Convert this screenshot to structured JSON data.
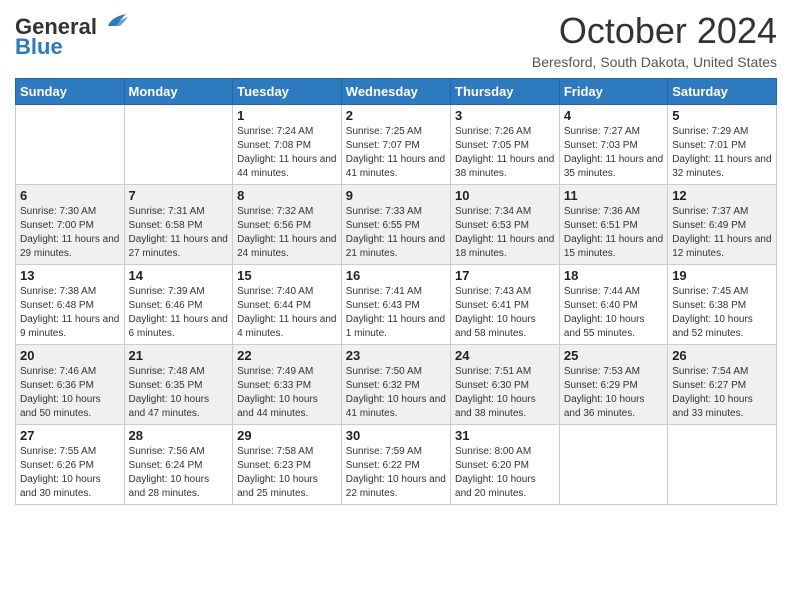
{
  "header": {
    "logo_general": "General",
    "logo_blue": "Blue",
    "month_title": "October 2024",
    "subtitle": "Beresford, South Dakota, United States"
  },
  "days_of_week": [
    "Sunday",
    "Monday",
    "Tuesday",
    "Wednesday",
    "Thursday",
    "Friday",
    "Saturday"
  ],
  "weeks": [
    [
      {
        "day": "",
        "sunrise": "",
        "sunset": "",
        "daylight": ""
      },
      {
        "day": "",
        "sunrise": "",
        "sunset": "",
        "daylight": ""
      },
      {
        "day": "1",
        "sunrise": "Sunrise: 7:24 AM",
        "sunset": "Sunset: 7:08 PM",
        "daylight": "Daylight: 11 hours and 44 minutes."
      },
      {
        "day": "2",
        "sunrise": "Sunrise: 7:25 AM",
        "sunset": "Sunset: 7:07 PM",
        "daylight": "Daylight: 11 hours and 41 minutes."
      },
      {
        "day": "3",
        "sunrise": "Sunrise: 7:26 AM",
        "sunset": "Sunset: 7:05 PM",
        "daylight": "Daylight: 11 hours and 38 minutes."
      },
      {
        "day": "4",
        "sunrise": "Sunrise: 7:27 AM",
        "sunset": "Sunset: 7:03 PM",
        "daylight": "Daylight: 11 hours and 35 minutes."
      },
      {
        "day": "5",
        "sunrise": "Sunrise: 7:29 AM",
        "sunset": "Sunset: 7:01 PM",
        "daylight": "Daylight: 11 hours and 32 minutes."
      }
    ],
    [
      {
        "day": "6",
        "sunrise": "Sunrise: 7:30 AM",
        "sunset": "Sunset: 7:00 PM",
        "daylight": "Daylight: 11 hours and 29 minutes."
      },
      {
        "day": "7",
        "sunrise": "Sunrise: 7:31 AM",
        "sunset": "Sunset: 6:58 PM",
        "daylight": "Daylight: 11 hours and 27 minutes."
      },
      {
        "day": "8",
        "sunrise": "Sunrise: 7:32 AM",
        "sunset": "Sunset: 6:56 PM",
        "daylight": "Daylight: 11 hours and 24 minutes."
      },
      {
        "day": "9",
        "sunrise": "Sunrise: 7:33 AM",
        "sunset": "Sunset: 6:55 PM",
        "daylight": "Daylight: 11 hours and 21 minutes."
      },
      {
        "day": "10",
        "sunrise": "Sunrise: 7:34 AM",
        "sunset": "Sunset: 6:53 PM",
        "daylight": "Daylight: 11 hours and 18 minutes."
      },
      {
        "day": "11",
        "sunrise": "Sunrise: 7:36 AM",
        "sunset": "Sunset: 6:51 PM",
        "daylight": "Daylight: 11 hours and 15 minutes."
      },
      {
        "day": "12",
        "sunrise": "Sunrise: 7:37 AM",
        "sunset": "Sunset: 6:49 PM",
        "daylight": "Daylight: 11 hours and 12 minutes."
      }
    ],
    [
      {
        "day": "13",
        "sunrise": "Sunrise: 7:38 AM",
        "sunset": "Sunset: 6:48 PM",
        "daylight": "Daylight: 11 hours and 9 minutes."
      },
      {
        "day": "14",
        "sunrise": "Sunrise: 7:39 AM",
        "sunset": "Sunset: 6:46 PM",
        "daylight": "Daylight: 11 hours and 6 minutes."
      },
      {
        "day": "15",
        "sunrise": "Sunrise: 7:40 AM",
        "sunset": "Sunset: 6:44 PM",
        "daylight": "Daylight: 11 hours and 4 minutes."
      },
      {
        "day": "16",
        "sunrise": "Sunrise: 7:41 AM",
        "sunset": "Sunset: 6:43 PM",
        "daylight": "Daylight: 11 hours and 1 minute."
      },
      {
        "day": "17",
        "sunrise": "Sunrise: 7:43 AM",
        "sunset": "Sunset: 6:41 PM",
        "daylight": "Daylight: 10 hours and 58 minutes."
      },
      {
        "day": "18",
        "sunrise": "Sunrise: 7:44 AM",
        "sunset": "Sunset: 6:40 PM",
        "daylight": "Daylight: 10 hours and 55 minutes."
      },
      {
        "day": "19",
        "sunrise": "Sunrise: 7:45 AM",
        "sunset": "Sunset: 6:38 PM",
        "daylight": "Daylight: 10 hours and 52 minutes."
      }
    ],
    [
      {
        "day": "20",
        "sunrise": "Sunrise: 7:46 AM",
        "sunset": "Sunset: 6:36 PM",
        "daylight": "Daylight: 10 hours and 50 minutes."
      },
      {
        "day": "21",
        "sunrise": "Sunrise: 7:48 AM",
        "sunset": "Sunset: 6:35 PM",
        "daylight": "Daylight: 10 hours and 47 minutes."
      },
      {
        "day": "22",
        "sunrise": "Sunrise: 7:49 AM",
        "sunset": "Sunset: 6:33 PM",
        "daylight": "Daylight: 10 hours and 44 minutes."
      },
      {
        "day": "23",
        "sunrise": "Sunrise: 7:50 AM",
        "sunset": "Sunset: 6:32 PM",
        "daylight": "Daylight: 10 hours and 41 minutes."
      },
      {
        "day": "24",
        "sunrise": "Sunrise: 7:51 AM",
        "sunset": "Sunset: 6:30 PM",
        "daylight": "Daylight: 10 hours and 38 minutes."
      },
      {
        "day": "25",
        "sunrise": "Sunrise: 7:53 AM",
        "sunset": "Sunset: 6:29 PM",
        "daylight": "Daylight: 10 hours and 36 minutes."
      },
      {
        "day": "26",
        "sunrise": "Sunrise: 7:54 AM",
        "sunset": "Sunset: 6:27 PM",
        "daylight": "Daylight: 10 hours and 33 minutes."
      }
    ],
    [
      {
        "day": "27",
        "sunrise": "Sunrise: 7:55 AM",
        "sunset": "Sunset: 6:26 PM",
        "daylight": "Daylight: 10 hours and 30 minutes."
      },
      {
        "day": "28",
        "sunrise": "Sunrise: 7:56 AM",
        "sunset": "Sunset: 6:24 PM",
        "daylight": "Daylight: 10 hours and 28 minutes."
      },
      {
        "day": "29",
        "sunrise": "Sunrise: 7:58 AM",
        "sunset": "Sunset: 6:23 PM",
        "daylight": "Daylight: 10 hours and 25 minutes."
      },
      {
        "day": "30",
        "sunrise": "Sunrise: 7:59 AM",
        "sunset": "Sunset: 6:22 PM",
        "daylight": "Daylight: 10 hours and 22 minutes."
      },
      {
        "day": "31",
        "sunrise": "Sunrise: 8:00 AM",
        "sunset": "Sunset: 6:20 PM",
        "daylight": "Daylight: 10 hours and 20 minutes."
      },
      {
        "day": "",
        "sunrise": "",
        "sunset": "",
        "daylight": ""
      },
      {
        "day": "",
        "sunrise": "",
        "sunset": "",
        "daylight": ""
      }
    ]
  ]
}
